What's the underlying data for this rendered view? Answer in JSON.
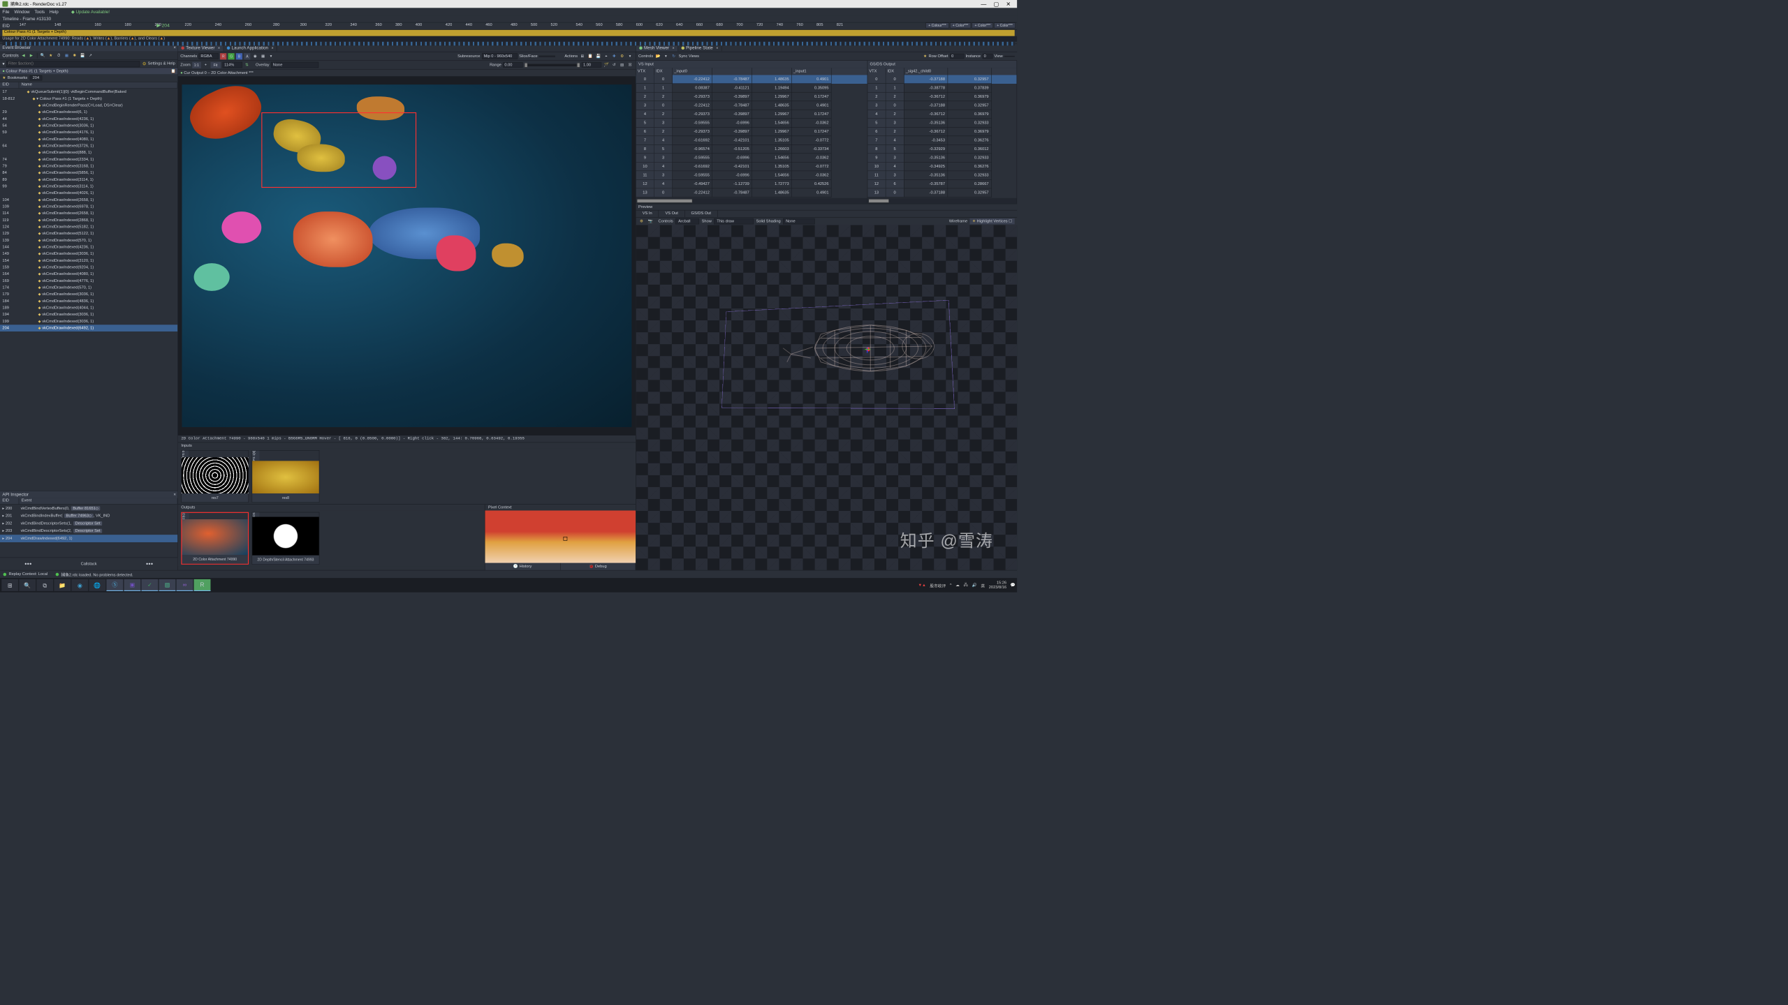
{
  "app": {
    "title": "捕鱼2.rdc - RenderDoc v1.27",
    "menu": [
      "File",
      "Window",
      "Tools",
      "Help"
    ],
    "update": "◆ Update Available!",
    "timeline": "Timeline - Frame #13130",
    "timeline_bar": "Colour Pass #1 (1 Targets + Depth)",
    "usage_label": "Usage for 2D Color Attachment 74990: Reads",
    "usage_writes": "Writes",
    "usage_barriers": "Barriers",
    "usage_clears": "and Clears",
    "eid_label": "EID",
    "ticks": [
      {
        "v": 147,
        "p": 0.5
      },
      {
        "v": 148,
        "p": 4
      },
      {
        "v": 160,
        "p": 8
      },
      {
        "v": 180,
        "p": 11
      },
      {
        "v": 200,
        "p": 14
      },
      {
        "v": 220,
        "p": 17
      },
      {
        "v": 240,
        "p": 20
      },
      {
        "v": 260,
        "p": 23
      },
      {
        "v": 280,
        "p": 25.8
      },
      {
        "v": 300,
        "p": 28.5
      },
      {
        "v": 320,
        "p": 31
      },
      {
        "v": 340,
        "p": 33.5
      },
      {
        "v": 360,
        "p": 36
      },
      {
        "v": 380,
        "p": 38
      },
      {
        "v": 400,
        "p": 40
      },
      {
        "v": 420,
        "p": 43
      },
      {
        "v": 440,
        "p": 45
      },
      {
        "v": 460,
        "p": 47
      },
      {
        "v": 480,
        "p": 49.5
      },
      {
        "v": 500,
        "p": 51.5
      },
      {
        "v": 520,
        "p": 53.5
      },
      {
        "v": 540,
        "p": 56
      },
      {
        "v": 560,
        "p": 58
      },
      {
        "v": 580,
        "p": 60
      },
      {
        "v": 600,
        "p": 62
      },
      {
        "v": 620,
        "p": 64
      },
      {
        "v": 640,
        "p": 66
      },
      {
        "v": 660,
        "p": 68
      },
      {
        "v": 680,
        "p": 70
      },
      {
        "v": 700,
        "p": 72
      },
      {
        "v": 720,
        "p": 74
      },
      {
        "v": 740,
        "p": 76
      },
      {
        "v": 760,
        "p": 78
      },
      {
        "v": 805,
        "p": 80
      },
      {
        "v": 821,
        "p": 82
      }
    ],
    "marker_pos": 14.2,
    "marker_val": 204,
    "color_btns": [
      "+ Colour***",
      "+ Color***",
      "+ Color***",
      "+ Color***"
    ]
  },
  "event_browser": {
    "title": "Event Browser",
    "controls_label": "Controls",
    "filter_placeholder": "Filter $action()",
    "settings": "Settings & Help",
    "pass_label": "Colour Pass #1 (1 Targets + Depth)",
    "bookmarks": "Bookmarks",
    "bookmark_num": "204",
    "col_eid": "EID",
    "col_name": "Name",
    "rows": [
      {
        "eid": "17",
        "name": "vkQueueSubmit(1)[0]: vkBeginCommandBuffer(Baked",
        "ind": 0
      },
      {
        "eid": "18-812",
        "name": "▾ Colour Pass #1 (1 Targets + Depth)",
        "ind": 1
      },
      {
        "eid": "",
        "name": "vkCmdBeginRenderPass(C=Load, DS=Clear)",
        "ind": 2
      },
      {
        "eid": "29",
        "name": "vkCmdDrawIndexed(6, 1)",
        "ind": 2
      },
      {
        "eid": "44",
        "name": "vkCmdDrawIndexed(4236, 1)",
        "ind": 2
      },
      {
        "eid": "54",
        "name": "vkCmdDrawIndexed(3036, 1)",
        "ind": 2
      },
      {
        "eid": "59",
        "name": "vkCmdDrawIndexed(4176, 1)",
        "ind": 2
      },
      {
        "eid": "",
        "name": "vkCmdDrawIndexed(4080, 1)",
        "ind": 2
      },
      {
        "eid": "64",
        "name": "vkCmdDrawIndexed(3726, 1)",
        "ind": 2
      },
      {
        "eid": "",
        "name": "vkCmdDrawIndexed(888, 1)",
        "ind": 2
      },
      {
        "eid": "74",
        "name": "vkCmdDrawIndexed(2334, 1)",
        "ind": 2
      },
      {
        "eid": "79",
        "name": "vkCmdDrawIndexed(3168, 1)",
        "ind": 2
      },
      {
        "eid": "84",
        "name": "vkCmdDrawIndexed(5856, 1)",
        "ind": 2
      },
      {
        "eid": "89",
        "name": "vkCmdDrawIndexed(3114, 1)",
        "ind": 2
      },
      {
        "eid": "99",
        "name": "vkCmdDrawIndexed(3114, 1)",
        "ind": 2
      },
      {
        "eid": "",
        "name": "vkCmdDrawIndexed(4026, 1)",
        "ind": 2
      },
      {
        "eid": "104",
        "name": "vkCmdDrawIndexed(2658, 1)",
        "ind": 2
      },
      {
        "eid": "109",
        "name": "vkCmdDrawIndexed(6978, 1)",
        "ind": 2
      },
      {
        "eid": "114",
        "name": "vkCmdDrawIndexed(2658, 1)",
        "ind": 2
      },
      {
        "eid": "119",
        "name": "vkCmdDrawIndexed(2868, 1)",
        "ind": 2
      },
      {
        "eid": "124",
        "name": "vkCmdDrawIndexed(5182, 1)",
        "ind": 2
      },
      {
        "eid": "129",
        "name": "vkCmdDrawIndexed(5122, 1)",
        "ind": 2
      },
      {
        "eid": "139",
        "name": "vkCmdDrawIndexed(570, 1)",
        "ind": 2
      },
      {
        "eid": "144",
        "name": "vkCmdDrawIndexed(4236, 1)",
        "ind": 2
      },
      {
        "eid": "149",
        "name": "vkCmdDrawIndexed(3036, 1)",
        "ind": 2
      },
      {
        "eid": "154",
        "name": "vkCmdDrawIndexed(3120, 1)",
        "ind": 2
      },
      {
        "eid": "159",
        "name": "vkCmdDrawIndexed(9204, 1)",
        "ind": 2
      },
      {
        "eid": "164",
        "name": "vkCmdDrawIndexed(4080, 1)",
        "ind": 2
      },
      {
        "eid": "169",
        "name": "vkCmdDrawIndexed(4776, 1)",
        "ind": 2
      },
      {
        "eid": "174",
        "name": "vkCmdDrawIndexed(570, 1)",
        "ind": 2
      },
      {
        "eid": "179",
        "name": "vkCmdDrawIndexed(3036, 1)",
        "ind": 2
      },
      {
        "eid": "184",
        "name": "vkCmdDrawIndexed(4836, 1)",
        "ind": 2
      },
      {
        "eid": "189",
        "name": "vkCmdDrawIndexed(4044, 1)",
        "ind": 2
      },
      {
        "eid": "194",
        "name": "vkCmdDrawIndexed(3036, 1)",
        "ind": 2
      },
      {
        "eid": "199",
        "name": "vkCmdDrawIndexed(3036, 1)",
        "ind": 2
      },
      {
        "eid": "204",
        "name": "vkCmdDrawIndexed(6492, 1)",
        "ind": 2,
        "sel": true
      }
    ]
  },
  "api_inspector": {
    "title": "API Inspector",
    "col_eid": "EID",
    "col_event": "Event",
    "rows": [
      {
        "eid": "200",
        "ev": "vkCmdBindVertexBuffers(0,",
        "link": "Buffer 81651◇"
      },
      {
        "eid": "201",
        "ev": "vkCmdBindIndexBuffer(",
        "link": "Buffer 74963◇",
        "tail": ", VK_IND"
      },
      {
        "eid": "202",
        "ev": "vkCmdBindDescriptorSets(1,",
        "link": "Descriptor Set"
      },
      {
        "eid": "203",
        "ev": "vkCmdBindDescriptorSets(2,",
        "link": "Descriptor Set"
      },
      {
        "eid": "204",
        "ev": "vkCmdDrawIndexed(6492, 1)",
        "sel": true
      }
    ],
    "callstack": "Callstack"
  },
  "texture_viewer": {
    "tab_tex": "Texture Viewer",
    "tab_launch": "Launch Application",
    "channels_label": "Channels",
    "channels_value": "RGBA",
    "sub_label": "Subresource",
    "sub_value": "Mip 0 - 960x540",
    "slice_label": "Slice/Face",
    "actions_label": "Actions",
    "zoom_label": "Zoom",
    "zoom_11": "1:1",
    "zoom_fit": "Fit",
    "zoom_value": "114%",
    "overlay_label": "Overlay",
    "overlay_value": "None",
    "range_label": "Range",
    "range_min": "0.00",
    "range_max": "1.00",
    "crumb": "Cur Output 0 – 2D Color Attachment ***",
    "status": "2D Color Attachment 74990 - 960x540 1 mips - B5G6R5_UNORM    Hover - [ 816,    0 (0.8500, 0.0000)] - Right click -  382,  144: 0.70968, 0.63492, 0.19355",
    "inputs": "Inputs",
    "outputs": "Outputs",
    "pixel_context": "Pixel Context",
    "history": "History",
    "debug": "Debug",
    "in_thumbs": [
      {
        "side": "PS 0",
        "lbl": "res7"
      },
      {
        "side": "PS 1[0]",
        "lbl": "res8"
      }
    ],
    "out_thumbs": [
      {
        "side": "FBO",
        "lbl": "2D Color Attachment 74990",
        "sel": true
      },
      {
        "side": "DS",
        "lbl": "2D Depth/Stencil Attachment 74993"
      }
    ]
  },
  "mesh_viewer": {
    "tab_mesh": "Mesh Viewer",
    "tab_pipe": "Pipeline State",
    "controls": "Controls",
    "sync": "Sync Views",
    "row_offset_label": "Row Offset",
    "row_offset": "0",
    "instance_label": "Instance",
    "instance": "0",
    "view_label": "View",
    "vs_input": "VS Input",
    "vs_output": "GS/DS Output",
    "left_cols": [
      "VTX",
      "IDX",
      "_input0",
      "",
      "",
      "_input1"
    ],
    "right_cols": [
      "VTX",
      "IDX",
      "_sig42._child0",
      ""
    ],
    "left_rows": [
      {
        "vtx": 0,
        "idx": 0,
        "c": [
          "-0.22412",
          "-0.78487",
          "1.48635",
          " 0.4901"
        ],
        "sel": true
      },
      {
        "vtx": 1,
        "idx": 1,
        "c": [
          " 0.08387",
          "-0.41121",
          " 1.19494",
          " 0.35095"
        ]
      },
      {
        "vtx": 2,
        "idx": 2,
        "c": [
          "-0.29373",
          "-0.39897",
          " 1.29967",
          " 0.17247"
        ]
      },
      {
        "vtx": 3,
        "idx": 0,
        "c": [
          "-0.22412",
          "-0.78487",
          " 1.48635",
          " 0.4901"
        ]
      },
      {
        "vtx": 4,
        "idx": 2,
        "c": [
          "-0.29373",
          "-0.39897",
          " 1.29967",
          " 0.17247"
        ]
      },
      {
        "vtx": 5,
        "idx": 3,
        "c": [
          "-0.59555",
          "-0.6996",
          " 1.54656",
          "-0.0362"
        ]
      },
      {
        "vtx": 6,
        "idx": 2,
        "c": [
          "-0.29373",
          "-0.39897",
          " 1.29967",
          " 0.17247"
        ]
      },
      {
        "vtx": 7,
        "idx": 4,
        "c": [
          "-0.61692",
          "-0.42101",
          " 1.35105",
          "-0.0772"
        ]
      },
      {
        "vtx": 8,
        "idx": 5,
        "c": [
          "-0.96574",
          "-0.51205",
          " 1.26603",
          "-0.33734"
        ]
      },
      {
        "vtx": 9,
        "idx": 3,
        "c": [
          "-0.59555",
          "-0.6996",
          " 1.54656",
          "-0.0362"
        ]
      },
      {
        "vtx": 10,
        "idx": 4,
        "c": [
          "-0.61692",
          "-0.42101",
          " 1.35105",
          "-0.0772"
        ]
      },
      {
        "vtx": 11,
        "idx": 3,
        "c": [
          "-0.59555",
          "-0.6996",
          " 1.54656",
          "-0.0362"
        ]
      },
      {
        "vtx": 12,
        "idx": 4,
        "c": [
          "-0.49427",
          "-1.12739",
          " 1.72773",
          " 0.42526"
        ]
      },
      {
        "vtx": 13,
        "idx": 0,
        "c": [
          "-0.22412",
          "-0.78487",
          " 1.48635",
          " 0.4901"
        ]
      }
    ],
    "right_rows": [
      {
        "vtx": 0,
        "idx": 0,
        "c": [
          "-0.37188",
          " 0.32957"
        ],
        "sel": true
      },
      {
        "vtx": 1,
        "idx": 1,
        "c": [
          "-0.38778",
          " 0.37839"
        ]
      },
      {
        "vtx": 2,
        "idx": 2,
        "c": [
          "-0.36712",
          " 0.36979"
        ]
      },
      {
        "vtx": 3,
        "idx": 0,
        "c": [
          "-0.37188",
          " 0.32957"
        ]
      },
      {
        "vtx": 4,
        "idx": 2,
        "c": [
          "-0.36712",
          " 0.36979"
        ]
      },
      {
        "vtx": 5,
        "idx": 3,
        "c": [
          "-0.35136",
          " 0.32933"
        ]
      },
      {
        "vtx": 6,
        "idx": 2,
        "c": [
          "-0.36712",
          " 0.36979"
        ]
      },
      {
        "vtx": 7,
        "idx": 4,
        "c": [
          "-0.3453",
          " 0.36276"
        ]
      },
      {
        "vtx": 8,
        "idx": 5,
        "c": [
          "-0.32929",
          " 0.36012"
        ]
      },
      {
        "vtx": 9,
        "idx": 3,
        "c": [
          "-0.35136",
          " 0.32933"
        ]
      },
      {
        "vtx": 10,
        "idx": 4,
        "c": [
          "-0.34925",
          " 0.36276"
        ]
      },
      {
        "vtx": 11,
        "idx": 3,
        "c": [
          "-0.35136",
          " 0.32933"
        ]
      },
      {
        "vtx": 12,
        "idx": 6,
        "c": [
          "-0.35787",
          " 0.28667"
        ]
      },
      {
        "vtx": 13,
        "idx": 0,
        "c": [
          "-0.37188",
          " 0.32957"
        ]
      }
    ],
    "preview": "Preview",
    "ptabs": [
      "VS In",
      "VS Out",
      "GS/DS Out"
    ],
    "ctrl_label": "Controls",
    "ctrl_value": "Arcball",
    "show_label": "Show",
    "show_value": "This draw",
    "shading_label": "Solid Shading",
    "shading_value": "None",
    "wire": "Wireframe",
    "hlv": "Highlight Vertices"
  },
  "statusbar": {
    "replay": "Replay Context: Local",
    "msg": "捕鱼2.rdc loaded. No problems detected.",
    "stock": "股市收评"
  },
  "taskbar": {
    "time": "15:26",
    "date": "2023/8/16",
    "lang": "英"
  },
  "watermark": "知乎 @雪涛"
}
